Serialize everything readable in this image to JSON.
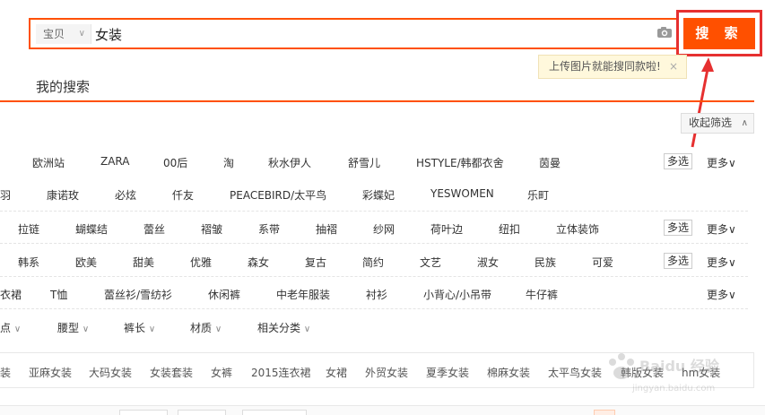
{
  "search": {
    "category": "宝贝",
    "query": "女装",
    "button_label": "搜 索"
  },
  "tooltip": {
    "text": "上传图片就能搜同款啦!",
    "close": "×"
  },
  "my_search": "我的搜索",
  "collapse_label": "收起筛选",
  "multi_label": "多选",
  "more_label": "更多",
  "filter_rows": [
    {
      "items": [
        "欧洲站",
        "ZARA",
        "00后",
        "淘",
        "秋水伊人",
        "舒雪儿",
        "HSTYLE/韩都衣舍",
        "茵曼"
      ],
      "multi": true,
      "more": true
    },
    {
      "items": [
        "羽",
        "康诺玫",
        "必炫",
        "仟友",
        "PEACEBIRD/太平鸟",
        "彩蝶妃",
        "YESWOMEN",
        "乐町"
      ],
      "multi": false,
      "more": false
    },
    {
      "items": [
        "拉链",
        "蝴蝶结",
        "蕾丝",
        "褶皱",
        "系带",
        "抽褶",
        "纱网",
        "荷叶边",
        "纽扣",
        "立体装饰"
      ],
      "multi": true,
      "more": true
    },
    {
      "items": [
        "韩系",
        "欧美",
        "甜美",
        "优雅",
        "森女",
        "复古",
        "简约",
        "文艺",
        "淑女",
        "民族",
        "可爱"
      ],
      "multi": true,
      "more": true
    },
    {
      "items": [
        "衣裙",
        "T恤",
        "蕾丝衫/雪纺衫",
        "休闲裤",
        "中老年服装",
        "衬衫",
        "小背心/小吊带",
        "牛仔裤"
      ],
      "multi": false,
      "more": true
    },
    {
      "items": [
        "点",
        "腰型",
        "裤长",
        "材质",
        "相关分类"
      ],
      "multi": false,
      "more": false,
      "dropdown": true
    }
  ],
  "related": [
    "装",
    "亚麻女装",
    "大码女装",
    "女装套装",
    "女裤",
    "2015连衣裙",
    "女裙",
    "外贸女装",
    "夏季女装",
    "棉麻女装",
    "太平鸟女装",
    "韩版女装",
    "hm女装"
  ],
  "watermark": "Baidu 经验 jingyan.baidu.com",
  "colors": {
    "accent": "#ff5000",
    "highlight": "#e63030",
    "tooltip_bg": "#fff8dc"
  }
}
